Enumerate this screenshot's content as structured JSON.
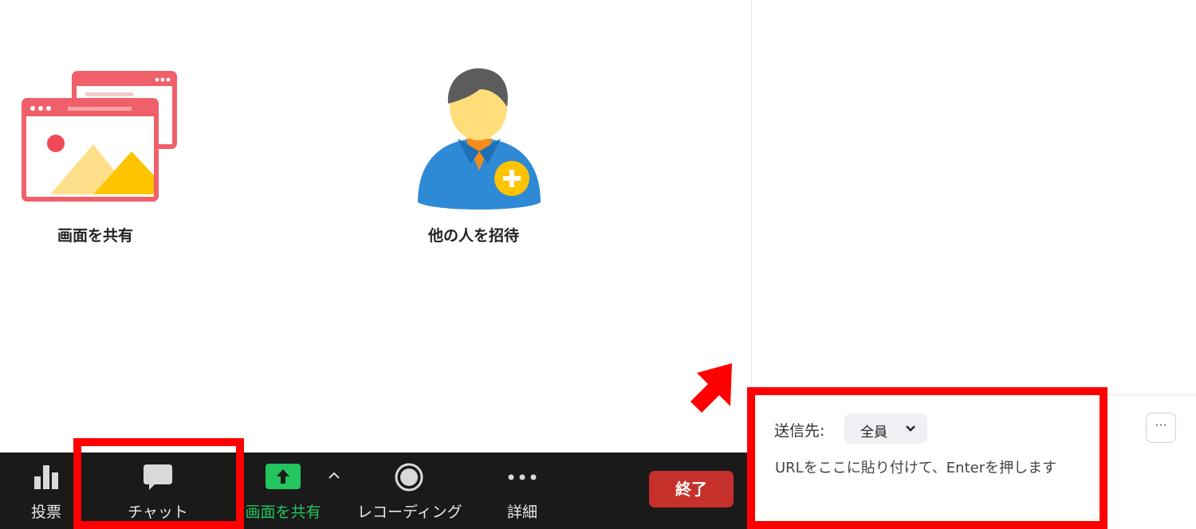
{
  "main": {
    "share_screen_label": "画面を共有",
    "invite_label": "他の人を招待"
  },
  "toolbar": {
    "poll_label": "投票",
    "chat_label": "チャット",
    "share_screen_label": "画面を共有",
    "recording_label": "レコーディング",
    "more_label": "詳細",
    "end_label": "終了"
  },
  "chat": {
    "send_to_label": "送信先:",
    "recipient": "全員",
    "message_placeholder": "URLをここに貼り付けて、Enterを押します",
    "more_glyph": "···"
  },
  "colors": {
    "toolbar_bg": "#1a1a1a",
    "share_green": "#22c55e",
    "end_red": "#c6302b",
    "highlight_red": "#ff0000"
  }
}
